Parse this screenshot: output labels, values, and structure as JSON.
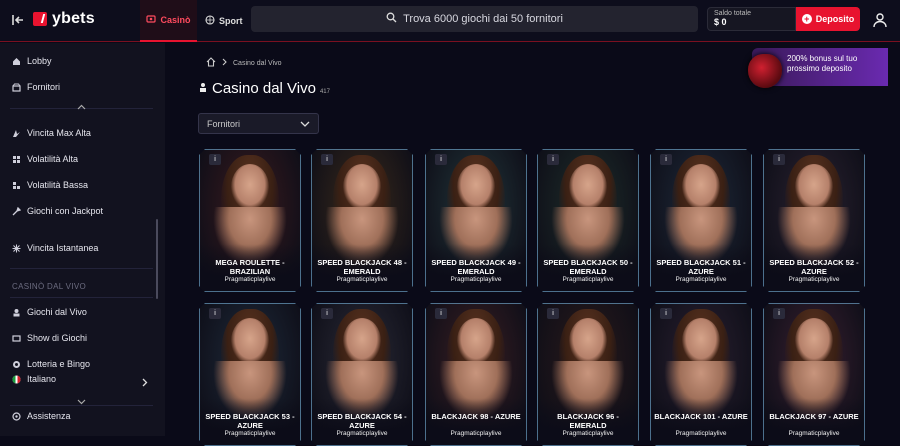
{
  "topbar": {
    "logo_text": "ybets",
    "tabs": [
      {
        "label": "Casinò"
      },
      {
        "label": "Sport"
      }
    ],
    "search_placeholder": "Trova 6000 giochi dai 50 fornitori",
    "balance_label": "Saldo totale",
    "balance_value": "$ 0",
    "deposit_label": "Deposito"
  },
  "sidebar": {
    "items": [
      {
        "label": "Lobby",
        "icon": "home-icon"
      },
      {
        "label": "Fornitori",
        "icon": "providers-icon"
      },
      {
        "label": "Vincita Max Alta",
        "icon": "max-win-icon"
      },
      {
        "label": "Volatilità Alta",
        "icon": "high-volatility-icon"
      },
      {
        "label": "Volatilità Bassa",
        "icon": "low-volatility-icon"
      },
      {
        "label": "Giochi con Jackpot",
        "icon": "jackpot-icon"
      },
      {
        "label": "Vincita Istantanea",
        "icon": "instant-win-icon"
      }
    ],
    "section_title": "CASINÒ DAL VIVO",
    "section_items": [
      {
        "label": "Giochi dal Vivo",
        "icon": "live-games-icon"
      },
      {
        "label": "Show di Giochi",
        "icon": "game-show-icon"
      },
      {
        "label": "Lotteria e Bingo",
        "icon": "lottery-icon"
      }
    ],
    "language": "Italiano",
    "support": "Assistenza"
  },
  "breadcrumb": {
    "current": "Casino dal Vivo"
  },
  "page": {
    "title": "Casino dal Vivo",
    "count": "417"
  },
  "filter": {
    "providers_label": "Fornitori"
  },
  "promo": {
    "text": "200% bonus sul tuo prossimo deposito"
  },
  "games": [
    {
      "name": "MEGA ROULETTE - BRAZILIAN",
      "provider": "Pragmaticplaylive"
    },
    {
      "name": "SPEED BLACKJACK 48 - EMERALD",
      "provider": "Pragmaticplaylive"
    },
    {
      "name": "SPEED BLACKJACK 49 - EMERALD",
      "provider": "Pragmaticplaylive"
    },
    {
      "name": "SPEED BLACKJACK 50 - EMERALD",
      "provider": "Pragmaticplaylive"
    },
    {
      "name": "SPEED BLACKJACK 51 - AZURE",
      "provider": "Pragmaticplaylive"
    },
    {
      "name": "SPEED BLACKJACK 52 - AZURE",
      "provider": "Pragmaticplaylive"
    },
    {
      "name": "SPEED BLACKJACK 53 - AZURE",
      "provider": "Pragmaticplaylive"
    },
    {
      "name": "SPEED BLACKJACK 54 - AZURE",
      "provider": "Pragmaticplaylive"
    },
    {
      "name": "BLACKJACK 98 - AZURE",
      "provider": "Pragmaticplaylive"
    },
    {
      "name": "BLACKJACK 96 - EMERALD",
      "provider": "Pragmaticplaylive"
    },
    {
      "name": "BLACKJACK 101 - AZURE",
      "provider": "Pragmaticplaylive"
    },
    {
      "name": "BLACKJACK 97 - AZURE",
      "provider": "Pragmaticplaylive"
    }
  ],
  "colors": {
    "accent": "#e8132f",
    "background": "#0a0a18",
    "sidebar": "#12121f",
    "promo": "#6a2ab0"
  }
}
